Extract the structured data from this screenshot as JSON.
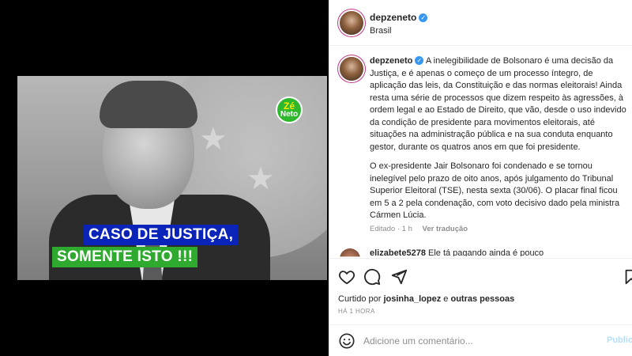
{
  "post": {
    "author": "depzeneto",
    "location": "Brasil",
    "caption_p1": "A inelegibilidade de Bolsonaro é uma decisão da Justiça, e é apenas o começo de um processo íntegro, de aplicação das leis, da Constituição e das normas eleitorais! Ainda resta uma série de processos que dizem respeito às agressões, à ordem legal e ao Estado de Direito, que vão, desde o uso indevido da condição de presidente para movimentos eleitorais, até situações na administração pública e na sua conduta enquanto gestor, durante os quatros anos em que foi presidente.",
    "caption_p2": "O ex-presidente Jair Bolsonaro foi condenado e se tornou inelegível pelo prazo de oito anos, após julgamento do Tribunal Superior Eleitoral (TSE), nesta sexta (30/06). O placar final ficou em 5 a 2 pela condenação, com voto decisivo dado pela ministra Cármen Lúcia.",
    "edited": "Editado · 1 h",
    "translate": "Ver tradução"
  },
  "media": {
    "badge_line1": "Zé",
    "badge_line2": "Neto",
    "caption_line1": "CASO DE JUSTIÇA,",
    "caption_line2": "SOMENTE ISTO !!!"
  },
  "comment_peek": {
    "user": "elizabete5278",
    "text": "Ele tá pagando ainda é pouco"
  },
  "likes": {
    "prefix": "Curtido por",
    "user": "josinha_lopez",
    "middle": "e",
    "others": "outras pessoas"
  },
  "time_ago": "HÁ 1 HORA",
  "add_comment": {
    "placeholder": "Adicione um comentário...",
    "publish": "Publicar"
  },
  "colors": {
    "verified": "#3897f0",
    "caption1_bg": "#0a23b8",
    "caption2_bg": "#2eaa2e"
  }
}
